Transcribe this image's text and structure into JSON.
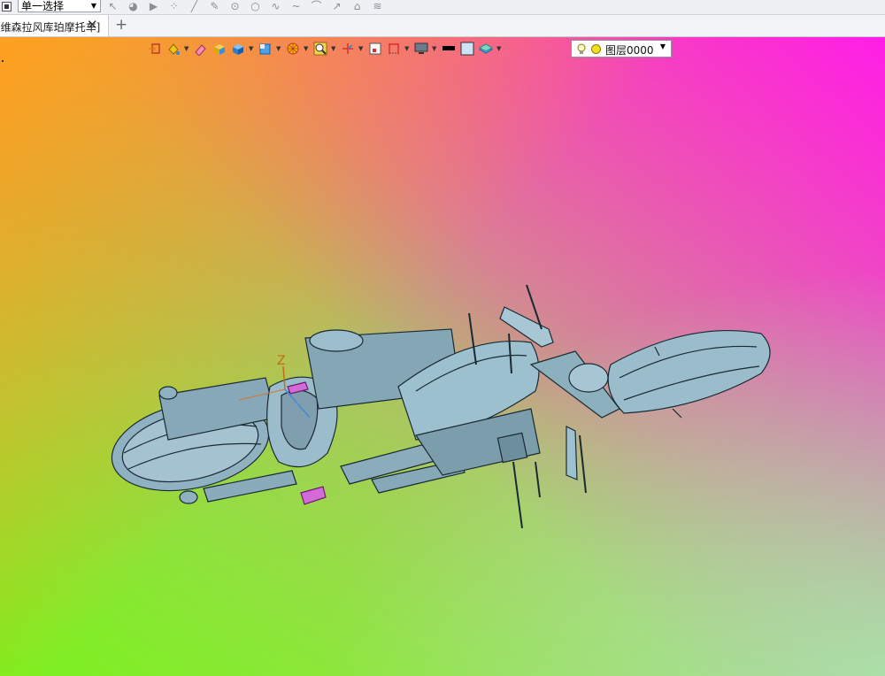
{
  "top_toolbar": {
    "selection_mode": "单一选择",
    "tool_icons": [
      "select-arrow-icon",
      "camera-icon",
      "play-icon",
      "scatter-icon",
      "line-icon",
      "pen-icon",
      "circle-point-icon",
      "circle-icon",
      "curve-icon",
      "wave-icon",
      "arc-icon",
      "arrow-icon",
      "hat-icon",
      "layers-icon"
    ]
  },
  "tabs": {
    "document_tab_label": "[哈雷戴维森拉风库珀摩托车]",
    "add_tab_symbol": "+",
    "close_symbol": "✕"
  },
  "view_toolbar": {
    "buttons": [
      "exit-icon",
      "bucket-icon",
      "eraser-icon",
      "shade-cube-icon",
      "cube-icon",
      "view-cube-icon",
      "wheel-icon",
      "zoom-icon",
      "axis-icon",
      "frame-icon",
      "section-icon",
      "display-icon",
      "color-black-icon",
      "color-lightblue-icon",
      "layer-stack-icon"
    ],
    "layer_label": "图层0000"
  },
  "viewport": {
    "axis_label": "Z",
    "model_color": "#8fb1c1"
  }
}
